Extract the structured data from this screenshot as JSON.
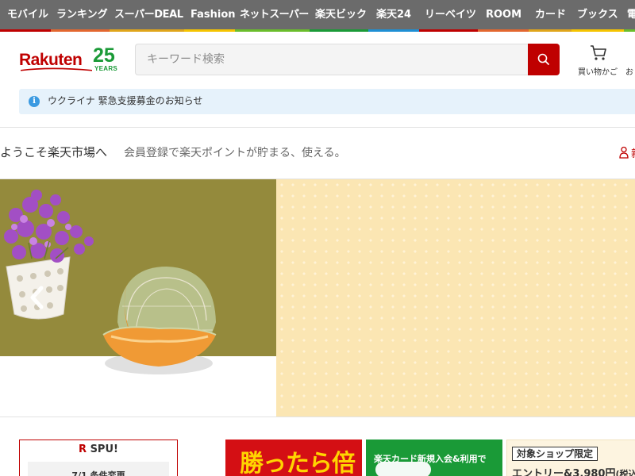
{
  "top_nav": {
    "items": [
      {
        "label": "モバイル",
        "stripe": "#bf0000"
      },
      {
        "label": "ランキング",
        "stripe": "#e3672f"
      },
      {
        "label": "スーパーDEAL",
        "stripe": "#e0a51b"
      },
      {
        "label": "Fashion",
        "stripe": "#f5c400"
      },
      {
        "label": "ネットスーパー",
        "stripe": "#6abd2b"
      },
      {
        "label": "楽天ビック",
        "stripe": "#1a9a37"
      },
      {
        "label": "楽天24",
        "stripe": "#1e8fd4"
      },
      {
        "label": "リーベイツ",
        "stripe": "#bf0000"
      },
      {
        "label": "ROOM",
        "stripe": "#e3672f"
      },
      {
        "label": "カード",
        "stripe": "#e0a51b"
      },
      {
        "label": "ブックス",
        "stripe": "#f5c400"
      },
      {
        "label": "電",
        "stripe": "#6abd2b"
      }
    ]
  },
  "header": {
    "logo_text": "Rakuten",
    "logo_anniversary": "25",
    "logo_years": "YEARS",
    "search_placeholder": "キーワード検索",
    "search_icon": "search-icon",
    "cart_label": "買い物かご",
    "cutoff_label": "お"
  },
  "notice": {
    "icon": "info-icon",
    "text": "ウクライナ 緊急支援募金のお知らせ"
  },
  "welcome": {
    "title": "ようこそ楽天市場へ",
    "subtitle": "会員登録で楽天ポイントが貯まる、使える。",
    "member_link": "新",
    "member_icon": "person-icon"
  },
  "banners": {
    "spu_title_r": "R",
    "spu_title": " SPU!",
    "spu_sub": "7/1 条件変更",
    "red_text": "勝ったら倍",
    "green_text": "楽天カード新規入会&利用で",
    "cream_tag": "対象ショップ限定",
    "cream_text": "エントリー&3,980円",
    "cream_small": "(税込)"
  },
  "colors": {
    "brand_red": "#bf0000",
    "nav_bg": "#6b6b6b",
    "notice_bg": "#e6f2fb"
  }
}
